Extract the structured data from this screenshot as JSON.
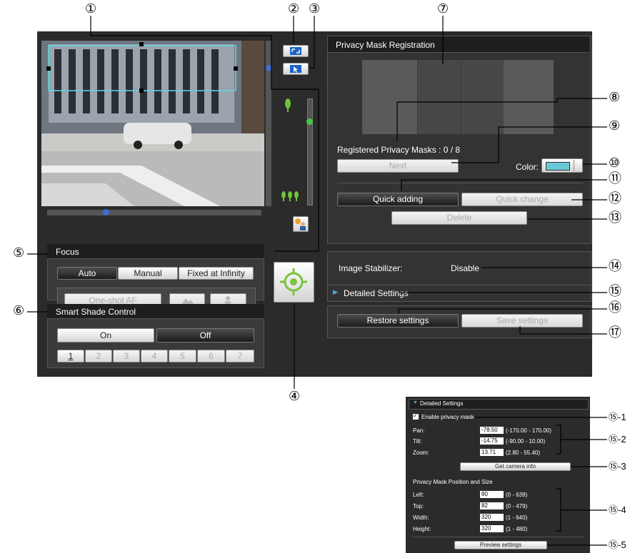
{
  "callouts": {
    "n1": "①",
    "n2": "②",
    "n3": "③",
    "n4": "④",
    "n5": "⑤",
    "n6": "⑥",
    "n7": "⑦",
    "n8": "⑧",
    "n9": "⑨",
    "n10": "⑩",
    "n11": "⑪",
    "n12": "⑫",
    "n13": "⑬",
    "n14": "⑭",
    "n15": "⑮",
    "n16": "⑯",
    "n17": "⑰",
    "n15_1": "⑮-1",
    "n15_2": "⑮-2",
    "n15_3": "⑮-3",
    "n15_4": "⑮-4",
    "n15_5": "⑮-5"
  },
  "focus": {
    "title": "Focus",
    "modes": [
      "Auto",
      "Manual",
      "Fixed at Infinity"
    ],
    "one_shot": "One-shot AF"
  },
  "smart_shade": {
    "title": "Smart Shade Control",
    "on": "On",
    "off": "Off",
    "levels": [
      "1",
      "2",
      "3",
      "4",
      "5",
      "6",
      "7"
    ]
  },
  "privacy": {
    "title": "Privacy Mask Registration",
    "registered": "Registered Privacy Masks : 0 / 8",
    "next": "Next",
    "color_label": "Color:",
    "color_value": "#6ac8d8",
    "quick_adding": "Quick adding",
    "quick_change": "Quick change",
    "delete": "Delete"
  },
  "stabilizer": {
    "label": "Image Stabilizer:",
    "value": "Disable"
  },
  "detailed": {
    "label": "Detailed Settings",
    "arrow": "▶"
  },
  "restore": "Restore settings",
  "save": "Save settings",
  "detail_panel": {
    "title": "Detailed Settings",
    "arrow": "▼",
    "enable": "Enable privacy mask",
    "checkmark": "✓",
    "pan_label": "Pan:",
    "pan_value": "-78.50",
    "pan_range": "(-170.00 - 170.00)",
    "tilt_label": "Tilt:",
    "tilt_value": "-14.75",
    "tilt_range": "(-90.00 - 10.00)",
    "zoom_label": "Zoom:",
    "zoom_value": "13.71",
    "zoom_range": "(2.80 - 55.40)",
    "get_info": "Get camera info",
    "pos_title": "Privacy Mask Position and Size",
    "left_label": "Left:",
    "left_value": "80",
    "left_range": "(0 - 639)",
    "top_label": "Top:",
    "top_value": "82",
    "top_range": "(0 - 479)",
    "width_label": "Width:",
    "width_value": "320",
    "width_range": "(1 - 640)",
    "height_label": "Height:",
    "height_value": "320",
    "height_range": "(1 - 480)",
    "preview": "Preview settings"
  }
}
